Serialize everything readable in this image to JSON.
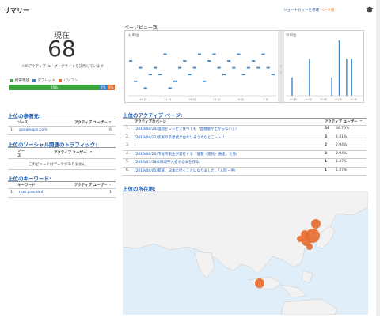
{
  "header": {
    "title": "サマリー",
    "shortcut_label": "ショートカットを作成",
    "shortcut_beta": "ベータ版",
    "cap_icon": "graduation-cap-icon"
  },
  "realtime": {
    "now_label": "現在",
    "now_value": "68",
    "description": "人のアクティブ ユーザーがサイトを訪問しています"
  },
  "devices": {
    "legend": [
      {
        "label": "携帯電話",
        "color": "#3aa53a"
      },
      {
        "label": "タブレット",
        "color": "#3b86c8"
      },
      {
        "label": "パソコン",
        "color": "#e66a2c"
      }
    ],
    "split": [
      {
        "label": "85%",
        "pct": 85,
        "color": "#3aa53a"
      },
      {
        "label": "7%",
        "pct": 7,
        "color": "#3b86c8"
      },
      {
        "label": "6%",
        "pct": 6,
        "color": "#e66a2c"
      }
    ]
  },
  "pageviews": {
    "title": "ページビュー数",
    "left_label": "分単位",
    "right_label": "秒単位",
    "x_ticks": [
      "-26 分",
      "-21 分",
      "-16 分",
      "-11 分",
      "-6 分",
      "-1 分"
    ],
    "right_ticks": [
      "-50 秒",
      "-40 秒",
      "-30 秒",
      "-20 秒",
      "-10 秒"
    ]
  },
  "chart_data": [
    {
      "type": "bar",
      "title": "分単位",
      "x": [
        -30,
        -29,
        -28,
        -27,
        -26,
        -25,
        -24,
        -23,
        -22,
        -21,
        -20,
        -19,
        -18,
        -17,
        -16,
        -15,
        -14,
        -13,
        -12,
        -11,
        -10,
        -9,
        -8,
        -7,
        -6,
        -5,
        -4,
        -3,
        -2,
        -1
      ],
      "values": [
        5,
        2,
        4,
        1,
        3,
        4,
        3,
        6,
        1,
        2,
        4,
        5,
        3,
        4,
        6,
        2,
        5,
        6,
        4,
        3,
        5,
        4,
        6,
        3,
        4,
        5,
        4,
        6,
        4,
        3
      ],
      "ylim": [
        0,
        7
      ]
    },
    {
      "type": "bar",
      "title": "秒単位",
      "x": [
        -60,
        -58,
        -56,
        -54,
        -52,
        -50,
        -48,
        -46,
        -44,
        -42,
        -40,
        -38,
        -36,
        -34,
        -32,
        -30,
        -28,
        -26,
        -24,
        -22,
        -20,
        -18,
        -16,
        -14,
        -12,
        -10,
        -8,
        -6,
        -4,
        -2
      ],
      "values": [
        0,
        0,
        1,
        0,
        0,
        0,
        0,
        0,
        0,
        2,
        0,
        0,
        0,
        0,
        0,
        0,
        0,
        0,
        1,
        0,
        0,
        3,
        0,
        0,
        2,
        0,
        2,
        0,
        0,
        0
      ],
      "ylim": [
        0,
        3
      ]
    }
  ],
  "referrals": {
    "title": "上位の参照元:",
    "col_source": "ソース",
    "col_users": "アクティブ ユーザー",
    "rows": [
      {
        "idx": "1.",
        "name": "googleapis.com",
        "users": "6"
      }
    ]
  },
  "social": {
    "title": "上位のソーシャル関連のトラフィック:",
    "col_source": "ソース",
    "col_users": "アクティブ ユーザー",
    "empty": "このビューにはデータがありません。"
  },
  "keywords": {
    "title": "上位のキーワード:",
    "col_kw": "キーワード",
    "col_users": "アクティブ ユーザー",
    "rows": [
      {
        "idx": "1.",
        "name": "(not provided)",
        "users": "1"
      }
    ]
  },
  "active_pages": {
    "title": "上位のアクティブ ページ:",
    "col_page": "アクティブなページ",
    "col_users": "アクティブ ユーザー",
    "rows": [
      {
        "idx": "1.",
        "page": "/2019/08/24/理屈をレシピで食べても「血糖値が上がらない」/",
        "users": "59",
        "pct": "86.76%"
      },
      {
        "idx": "2.",
        "page": "/2019/08/22/次男の卒業式が台なしそうやなどこ・・!/",
        "users": "3",
        "pct": "4.41%"
      },
      {
        "idx": "3.",
        "page": "/",
        "users": "2",
        "pct": "2.94%"
      },
      {
        "idx": "4.",
        "page": "/2019/08/20/市役所衛生が発行する「痩整（建物）通達」を見/",
        "users": "2",
        "pct": "2.94%"
      },
      {
        "idx": "5.",
        "page": "/2016/03/18/4日間平入会する本を作る/",
        "users": "1",
        "pct": "1.47%"
      },
      {
        "idx": "6.",
        "page": "/2019/08/05/家族、日本に行くことになりました。「入院・手/",
        "users": "1",
        "pct": "1.47%"
      }
    ]
  },
  "locations": {
    "title": "上位の所在地:"
  }
}
